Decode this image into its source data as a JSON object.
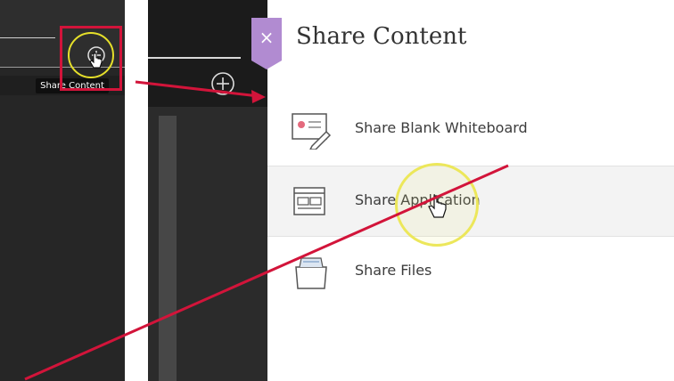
{
  "tooltip": {
    "text": "Share Content"
  },
  "panel": {
    "close_glyph": "×",
    "title": "Share Content",
    "items": [
      {
        "label": "Share Blank Whiteboard",
        "icon": "whiteboard-icon"
      },
      {
        "label": "Share Application",
        "icon": "application-window-icon"
      },
      {
        "label": "Share Files",
        "icon": "files-folder-icon"
      }
    ]
  },
  "colors": {
    "accent": "#b18bd1",
    "annotation": "#d2143a",
    "highlight": "#e6e02a"
  }
}
